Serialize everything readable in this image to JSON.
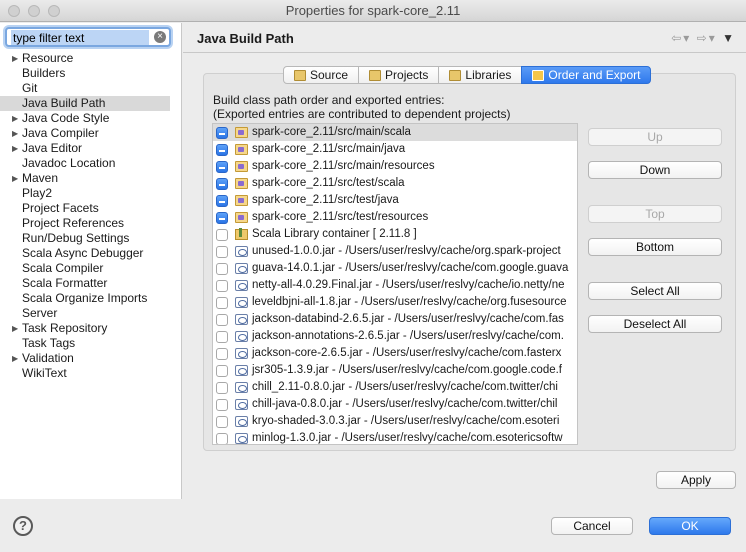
{
  "window": {
    "title": "Properties for spark-core_2.11"
  },
  "filter": {
    "value": "type filter text"
  },
  "sidebar": {
    "items": [
      {
        "label": "Resource",
        "expandable": true
      },
      {
        "label": "Builders",
        "expandable": false
      },
      {
        "label": "Git",
        "expandable": false
      },
      {
        "label": "Java Build Path",
        "expandable": false,
        "selected": true
      },
      {
        "label": "Java Code Style",
        "expandable": true
      },
      {
        "label": "Java Compiler",
        "expandable": true
      },
      {
        "label": "Java Editor",
        "expandable": true
      },
      {
        "label": "Javadoc Location",
        "expandable": false
      },
      {
        "label": "Maven",
        "expandable": true
      },
      {
        "label": "Play2",
        "expandable": false
      },
      {
        "label": "Project Facets",
        "expandable": false
      },
      {
        "label": "Project References",
        "expandable": false
      },
      {
        "label": "Run/Debug Settings",
        "expandable": false
      },
      {
        "label": "Scala Async Debugger",
        "expandable": false
      },
      {
        "label": "Scala Compiler",
        "expandable": false
      },
      {
        "label": "Scala Formatter",
        "expandable": false
      },
      {
        "label": "Scala Organize Imports",
        "expandable": false
      },
      {
        "label": "Server",
        "expandable": false
      },
      {
        "label": "Task Repository",
        "expandable": true
      },
      {
        "label": "Task Tags",
        "expandable": false
      },
      {
        "label": "Validation",
        "expandable": true
      },
      {
        "label": "WikiText",
        "expandable": false
      }
    ]
  },
  "page": {
    "title": "Java Build Path",
    "tabs": [
      {
        "label": "Source",
        "icon": "source-folder-icon",
        "active": false
      },
      {
        "label": "Projects",
        "icon": "projects-folder-icon",
        "active": false
      },
      {
        "label": "Libraries",
        "icon": "libraries-icon",
        "active": false
      },
      {
        "label": "Order and Export",
        "icon": "order-export-icon",
        "active": true
      }
    ],
    "description_line1": "Build class path order and exported entries:",
    "description_line2": "(Exported entries are contributed to dependent projects)",
    "entries": [
      {
        "label": "spark-core_2.11/src/main/scala",
        "type": "folder",
        "checked": true,
        "selected": true
      },
      {
        "label": "spark-core_2.11/src/main/java",
        "type": "folder",
        "checked": true
      },
      {
        "label": "spark-core_2.11/src/main/resources",
        "type": "folder",
        "checked": true
      },
      {
        "label": "spark-core_2.11/src/test/scala",
        "type": "folder",
        "checked": true
      },
      {
        "label": "spark-core_2.11/src/test/java",
        "type": "folder",
        "checked": true
      },
      {
        "label": "spark-core_2.11/src/test/resources",
        "type": "folder",
        "checked": true
      },
      {
        "label": "Scala Library container [ 2.11.8 ]",
        "type": "library",
        "checked": false
      },
      {
        "label": "unused-1.0.0.jar - /Users/user/reslvy/cache/org.spark-project",
        "type": "jar",
        "checked": false
      },
      {
        "label": "guava-14.0.1.jar - /Users/user/reslvy/cache/com.google.guava",
        "type": "jar",
        "checked": false
      },
      {
        "label": "netty-all-4.0.29.Final.jar - /Users/user/reslvy/cache/io.netty/ne",
        "type": "jar",
        "checked": false
      },
      {
        "label": "leveldbjni-all-1.8.jar - /Users/user/reslvy/cache/org.fusesource",
        "type": "jar",
        "checked": false
      },
      {
        "label": "jackson-databind-2.6.5.jar - /Users/user/reslvy/cache/com.fas",
        "type": "jar",
        "checked": false
      },
      {
        "label": "jackson-annotations-2.6.5.jar - /Users/user/reslvy/cache/com.",
        "type": "jar",
        "checked": false
      },
      {
        "label": "jackson-core-2.6.5.jar - /Users/user/reslvy/cache/com.fasterx",
        "type": "jar",
        "checked": false
      },
      {
        "label": "jsr305-1.3.9.jar - /Users/user/reslvy/cache/com.google.code.f",
        "type": "jar",
        "checked": false
      },
      {
        "label": "chill_2.11-0.8.0.jar - /Users/user/reslvy/cache/com.twitter/chi",
        "type": "jar",
        "checked": false
      },
      {
        "label": "chill-java-0.8.0.jar - /Users/user/reslvy/cache/com.twitter/chil",
        "type": "jar",
        "checked": false
      },
      {
        "label": "kryo-shaded-3.0.3.jar - /Users/user/reslvy/cache/com.esoteri",
        "type": "jar",
        "checked": false
      },
      {
        "label": "minlog-1.3.0.jar - /Users/user/reslvy/cache/com.esotericsoftw",
        "type": "jar",
        "checked": false
      }
    ],
    "buttons": {
      "up": "Up",
      "down": "Down",
      "top": "Top",
      "bottom": "Bottom",
      "select_all": "Select All",
      "deselect_all": "Deselect All",
      "apply": "Apply"
    }
  },
  "footer": {
    "help": "?",
    "cancel": "Cancel",
    "ok": "OK"
  },
  "colors": {
    "accent": "#2f79ec",
    "selection": "#d9d9d9"
  }
}
